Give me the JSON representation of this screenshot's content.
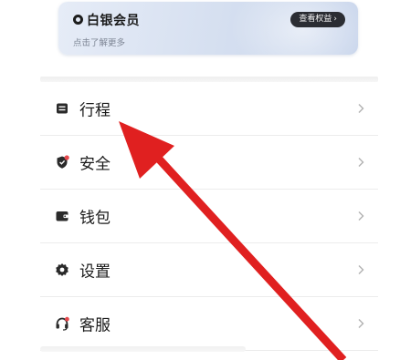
{
  "member_card": {
    "title": "白银会员",
    "subtitle": "点击了解更多",
    "benefit_button": "查看权益",
    "logo_icon": "member-ring-icon"
  },
  "menu": {
    "items": [
      {
        "label": "行程",
        "icon": "itinerary-icon"
      },
      {
        "label": "安全",
        "icon": "shield-icon"
      },
      {
        "label": "钱包",
        "icon": "wallet-icon"
      },
      {
        "label": "设置",
        "icon": "gear-icon"
      },
      {
        "label": "客服",
        "icon": "headset-icon"
      }
    ],
    "chevron_icon": "chevron-right-icon"
  },
  "annotation": {
    "type": "red-arrow",
    "color": "#e02020",
    "points_to": "行程"
  },
  "colors": {
    "badge_red": "#e5484d",
    "icon_dark": "#2a2a2a",
    "chevron": "#b0b0b0"
  }
}
